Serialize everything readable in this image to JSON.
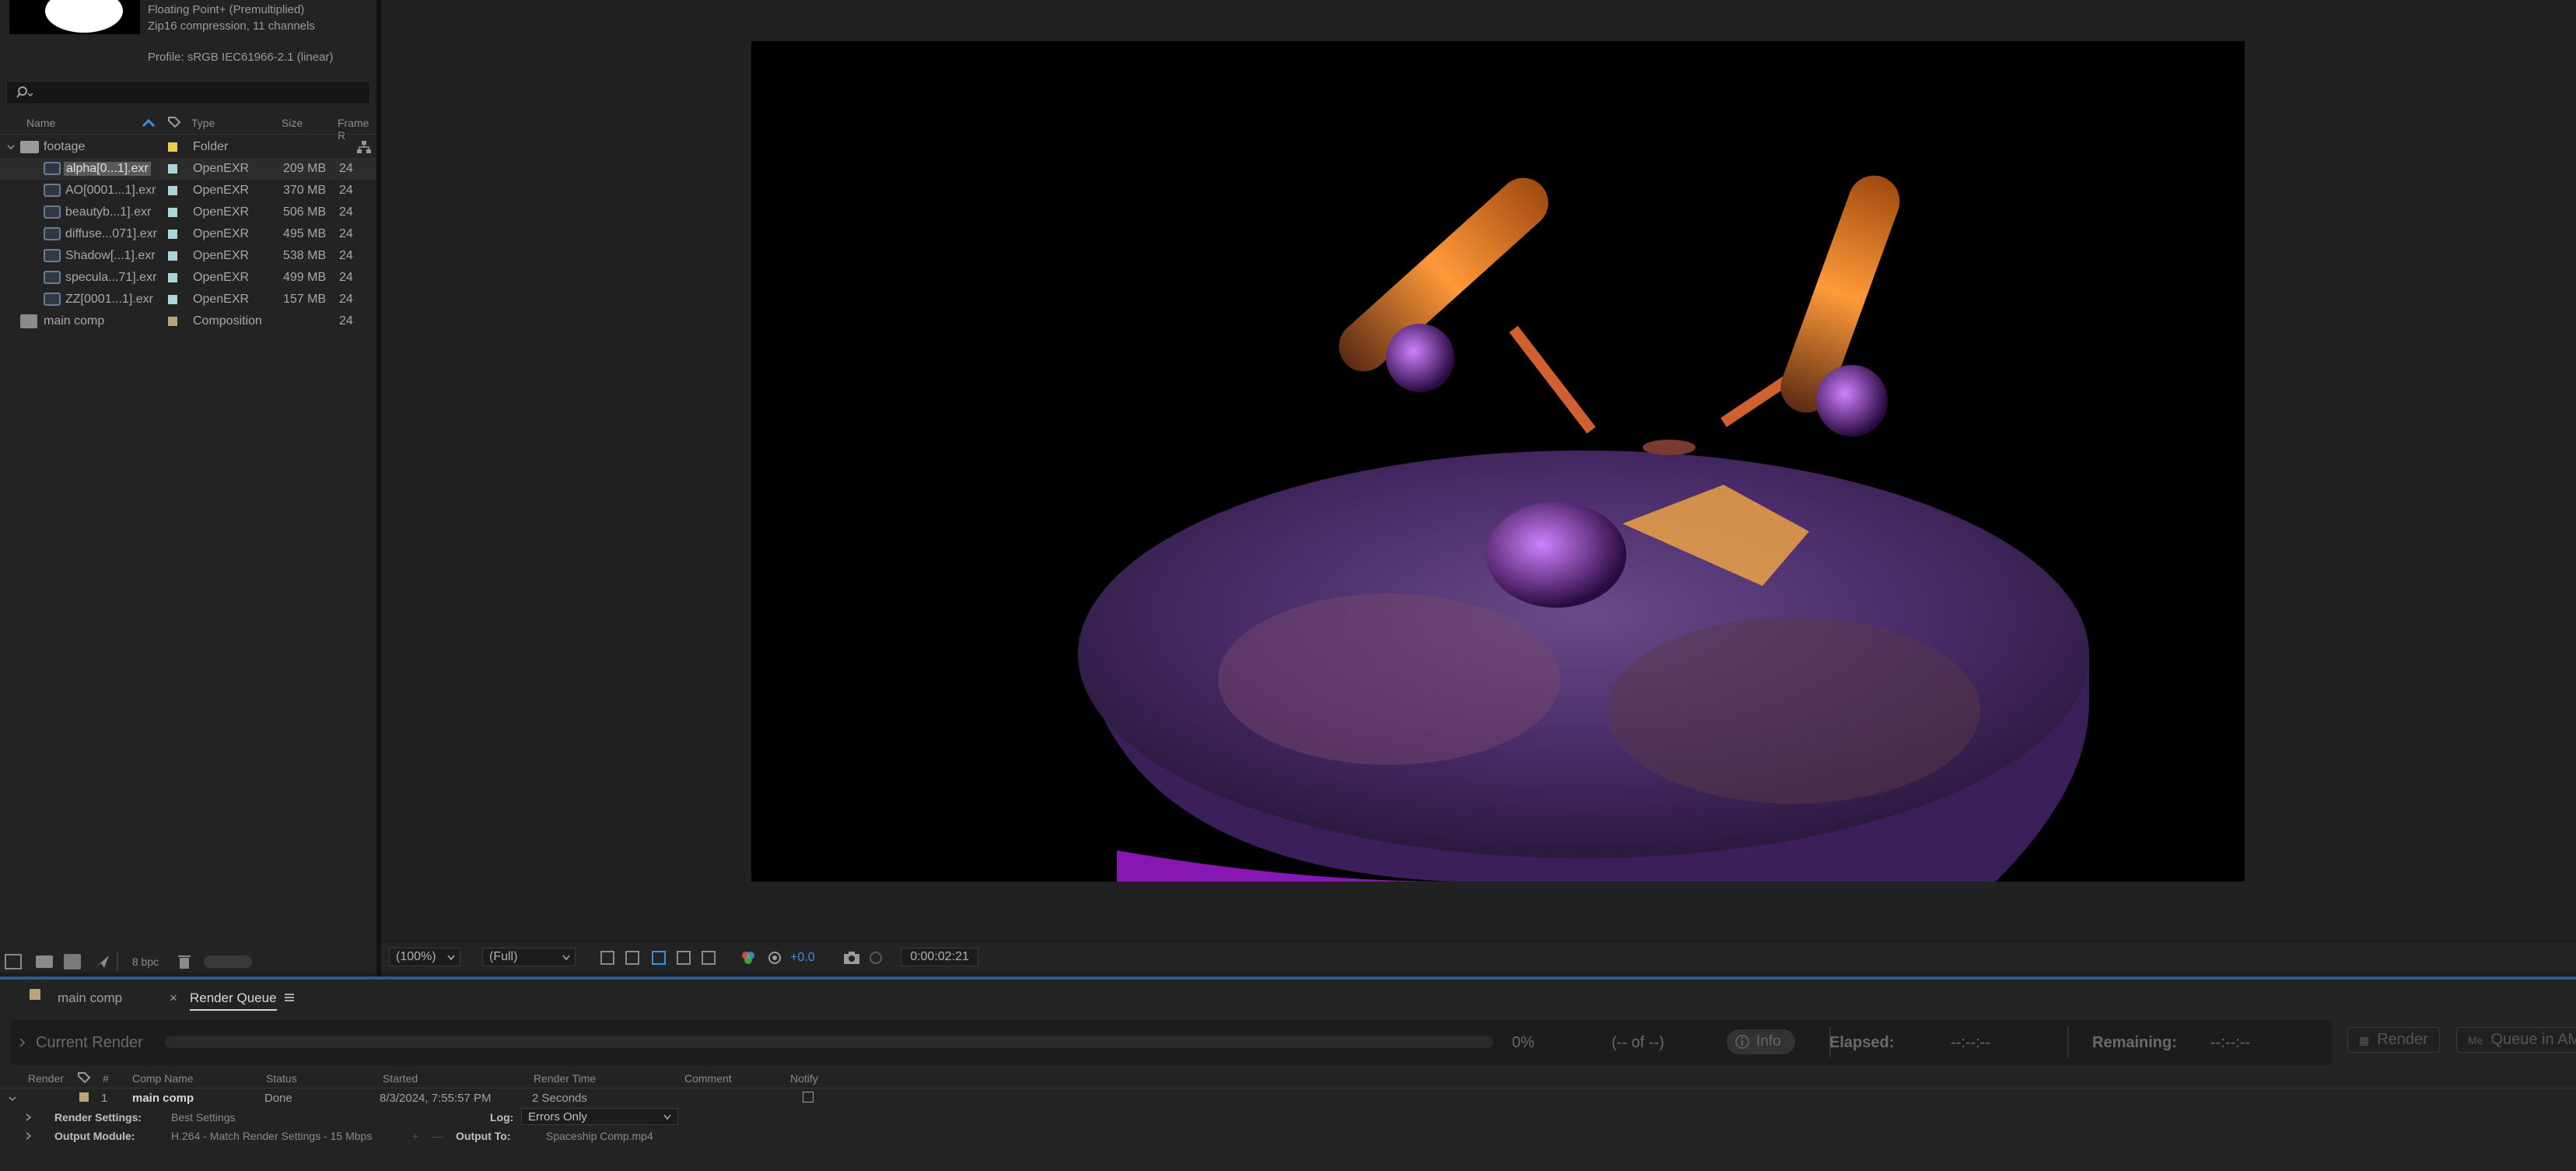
{
  "project_info": {
    "line1": "Floating Point+ (Premultiplied)",
    "line2": "Zip16 compression, 11 channels",
    "profile": "Profile: sRGB IEC61966-2.1 (linear)"
  },
  "project_columns": {
    "name": "Name",
    "type": "Type",
    "size": "Size",
    "frame": "Frame R"
  },
  "project_items": [
    {
      "name": "footage",
      "type": "Folder",
      "size": "",
      "frame": "",
      "label_color": "#e6cf4e",
      "kind": "folder"
    },
    {
      "name": "alpha[0...1].exr",
      "type": "OpenEXR",
      "size": "209 MB",
      "frame": "24",
      "label_color": "#a9d6d6",
      "kind": "footage"
    },
    {
      "name": "AO[0001...1].exr",
      "type": "OpenEXR",
      "size": "370 MB",
      "frame": "24",
      "label_color": "#a9d6d6",
      "kind": "footage"
    },
    {
      "name": "beautyb...1].exr",
      "type": "OpenEXR",
      "size": "506 MB",
      "frame": "24",
      "label_color": "#a9d6d6",
      "kind": "footage"
    },
    {
      "name": "diffuse...071].exr",
      "type": "OpenEXR",
      "size": "495 MB",
      "frame": "24",
      "label_color": "#a9d6d6",
      "kind": "footage"
    },
    {
      "name": "Shadow[...1].exr",
      "type": "OpenEXR",
      "size": "538 MB",
      "frame": "24",
      "label_color": "#a9d6d6",
      "kind": "footage"
    },
    {
      "name": "specula...71].exr",
      "type": "OpenEXR",
      "size": "499 MB",
      "frame": "24",
      "label_color": "#a9d6d6",
      "kind": "footage"
    },
    {
      "name": "ZZ[0001...1].exr",
      "type": "OpenEXR",
      "size": "157 MB",
      "frame": "24",
      "label_color": "#a9d6d6",
      "kind": "footage"
    },
    {
      "name": "main comp",
      "type": "Composition",
      "size": "",
      "frame": "24",
      "label_color": "#bda37a",
      "kind": "comp"
    }
  ],
  "project_bottom": {
    "bpc": "8 bpc"
  },
  "viewer_bar": {
    "zoom": "(100%)",
    "resolution": "(Full)",
    "exposure": "+0.0",
    "timecode": "0:00:02:21"
  },
  "tabs": {
    "main_comp": "main comp",
    "render_queue": "Render Queue"
  },
  "current_render": {
    "label": "Current Render",
    "percent": "0%",
    "of": "(-- of --)",
    "info": "Info",
    "elapsed_label": "Elapsed:",
    "elapsed": "--:--:--",
    "remaining_label": "Remaining:",
    "remaining": "--:--:--",
    "render_btn": "Render",
    "queue_btn": "Queue in AM"
  },
  "rq_columns": {
    "render": "Render",
    "num": "#",
    "comp": "Comp Name",
    "status": "Status",
    "started": "Started",
    "time": "Render Time",
    "comment": "Comment",
    "notify": "Notify"
  },
  "rq_item": {
    "num": "1",
    "comp": "main comp",
    "status": "Done",
    "started": "8/3/2024, 7:55:57 PM",
    "time": "2 Seconds"
  },
  "rq_settings": {
    "render_settings_label": "Render Settings:",
    "render_settings": "Best Settings",
    "log_label": "Log:",
    "log": "Errors Only",
    "output_module_label": "Output Module:",
    "output_module": "H.264 - Match Render Settings - 15 Mbps",
    "output_to_label": "Output To:",
    "output_to": "Spaceship Comp.mp4"
  }
}
